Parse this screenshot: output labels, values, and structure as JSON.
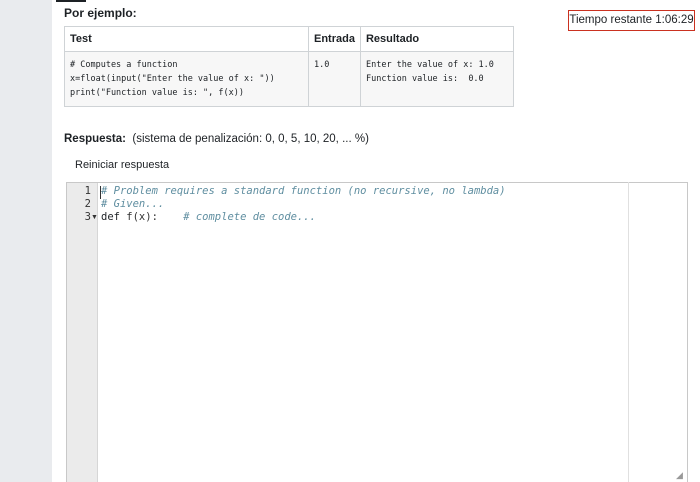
{
  "header": {
    "example_title": "Por ejemplo:",
    "timer": "Tiempo restante 1:06:29"
  },
  "example_table": {
    "columns": [
      "Test",
      "Entrada",
      "Resultado"
    ],
    "rows": [
      {
        "test": "# Computes a function\nx=float(input(\"Enter the value of x: \"))\nprint(\"Function value is: \", f(x))",
        "entrada": "1.0",
        "resultado": "Enter the value of x: 1.0\nFunction value is:  0.0"
      }
    ]
  },
  "answer": {
    "label": "Respuesta:",
    "penalty": "(sistema de penalización: 0, 0, 5, 10, 20, ... %)",
    "reset": "Reiniciar respuesta"
  },
  "editor": {
    "lines": [
      {
        "num": "1",
        "code": "# Problem requires a standard function (no recursive, no lambda)"
      },
      {
        "num": "2",
        "code": "# Given..."
      },
      {
        "num": "3",
        "keyword": "def",
        "code_main": " f(x):",
        "comment": "# complete de code..."
      }
    ]
  }
}
